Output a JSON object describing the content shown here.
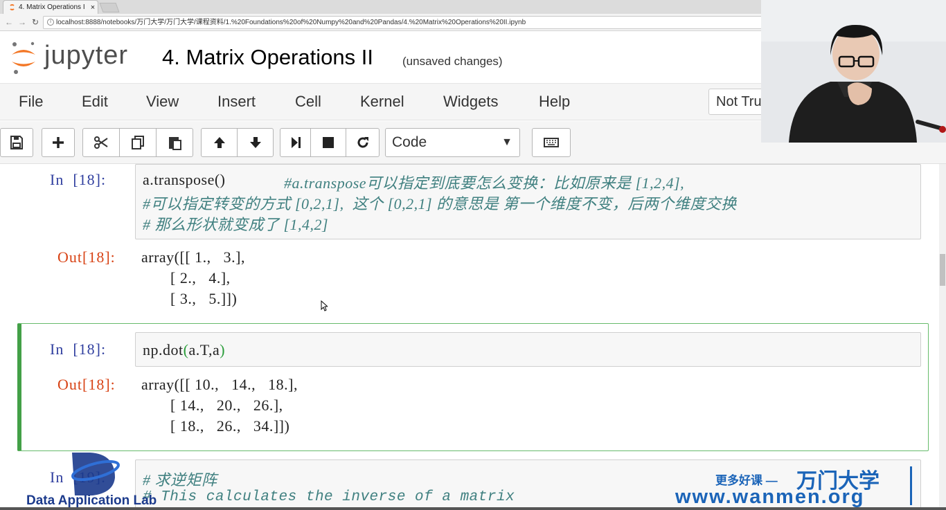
{
  "browser": {
    "tab_title": "4. Matrix Operations II",
    "tab_close": "×",
    "url": "localhost:8888/notebooks/万门大学/万门大学/课程资料/1.%20Foundations%20of%20Numpy%20and%20Pandas/4.%20Matrix%20Operations%20II.ipynb"
  },
  "header": {
    "logo_text": "jupyter",
    "notebook_title": "4. Matrix Operations II",
    "status": "(unsaved changes)"
  },
  "menubar": {
    "items": [
      "File",
      "Edit",
      "View",
      "Insert",
      "Cell",
      "Kernel",
      "Widgets",
      "Help"
    ],
    "trusted": "Not Trusted"
  },
  "toolbar": {
    "cell_type": "Code",
    "buttons": [
      "save-icon",
      "plus-icon",
      "scissors-icon",
      "copy-icon",
      "paste-icon",
      "arrow-up-icon",
      "arrow-down-icon",
      "step-forward-icon",
      "stop-icon",
      "restart-icon",
      "keyboard-icon"
    ]
  },
  "cells": {
    "c1": {
      "in_prompt": "In  [18]:",
      "code_fn": "a.transpose()",
      "comment_1": "#a.transpose可以指定到底要怎么变换：比如原来是 [1,2,4],",
      "comment_2": "#可以指定转变的方式 [0,2,1],  这个 [0,2,1] 的意思是 第一个维度不变，后两个维度交换",
      "comment_3": "# 那么形状就变成了 [1,4,2]",
      "out_prompt": "Out[18]:",
      "out_1": "array([[ 1.,   3.],",
      "out_2": "       [ 2.,   4.],",
      "out_3": "       [ 3.,   5.]])"
    },
    "c2": {
      "in_prompt": "In  [18]:",
      "code_pre": "np.dot",
      "code_open": "(",
      "code_args": "a.T,a",
      "code_close": ")",
      "out_prompt": "Out[18]:",
      "out_1": "array([[ 10.,   14.,   18.],",
      "out_2": "       [ 14.,   20.,   26.],",
      "out_3": "       [ 18.,   26.,   34.]])"
    },
    "c3": {
      "in_prompt": "In  [19]:",
      "comment_1": "# 求逆矩阵",
      "comment_2": "# This calculates the inverse of a matrix"
    }
  },
  "watermark": {
    "left_text": "Data Application Lab",
    "right_small": "更多好课 —",
    "right_brand": "万门大学",
    "right_url": "www.wanmen.org"
  },
  "colors": {
    "jupyter_orange": "#f37726",
    "prompt_in": "#303f9f",
    "prompt_out": "#d84315",
    "selected_border": "#43a047",
    "watermark_blue": "#1b64b8"
  }
}
